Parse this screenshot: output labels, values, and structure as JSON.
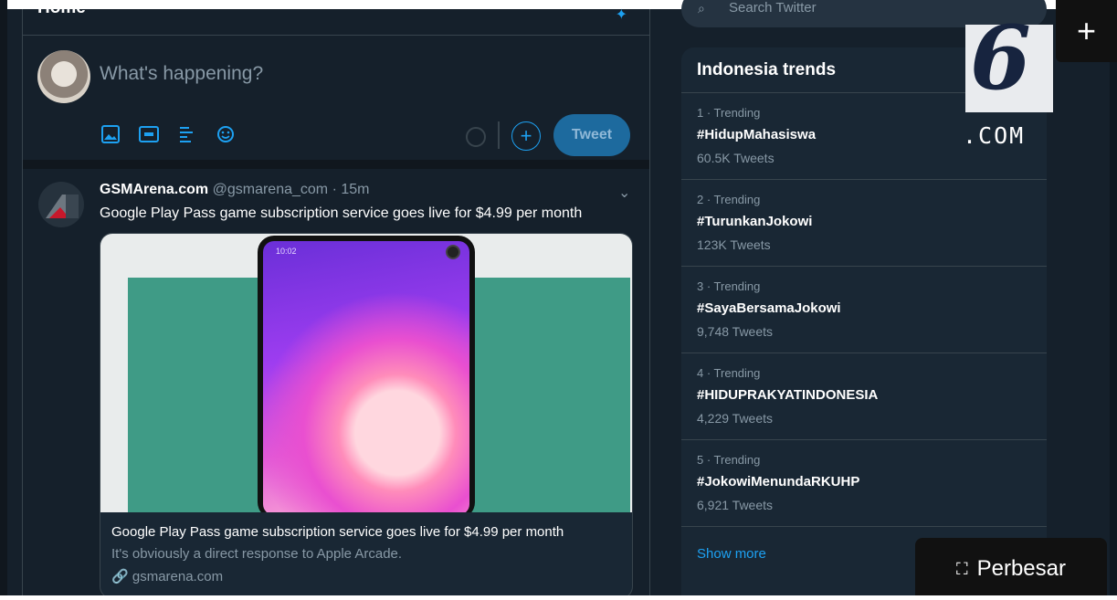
{
  "home": {
    "title": "Home"
  },
  "composer": {
    "placeholder": "What's happening?",
    "tweet_label": "Tweet"
  },
  "tweet": {
    "name": "GSMArena.com",
    "handle": "@gsmarena_com",
    "time": "· 15m",
    "text": "Google Play Pass game subscription service goes live for $4.99 per month",
    "card": {
      "status_time": "10:02",
      "title": "Google Play Pass game subscription service goes live for $4.99 per month",
      "description": "It's obviously a direct response to Apple Arcade.",
      "domain": "gsmarena.com"
    }
  },
  "search": {
    "placeholder": "Search Twitter"
  },
  "trends": {
    "title": "Indonesia trends",
    "items": [
      {
        "meta": "1 · Trending",
        "tag": "#HidupMahasiswa",
        "count": "60.5K Tweets"
      },
      {
        "meta": "2 · Trending",
        "tag": "#TurunkanJokowi",
        "count": "123K Tweets"
      },
      {
        "meta": "3 · Trending",
        "tag": "#SayaBersamaJokowi",
        "count": "9,748 Tweets"
      },
      {
        "meta": "4 · Trending",
        "tag": "#HIDUPRAKYATINDONESIA",
        "count": "4,229 Tweets"
      },
      {
        "meta": "5 · Trending",
        "tag": "#JokowiMenundaRKUHP",
        "count": "6,921 Tweets"
      }
    ],
    "show_more": "Show more"
  },
  "overlay": {
    "logo_number": "6",
    "logo_com": ".COM",
    "plus": "+",
    "enlarge_label": "Perbesar"
  },
  "icons": [
    "image-icon",
    "gif-icon",
    "poll-icon",
    "emoji-icon",
    "sparkle-icon",
    "chevron-down-icon",
    "link-icon",
    "search-icon",
    "expand-icon"
  ]
}
